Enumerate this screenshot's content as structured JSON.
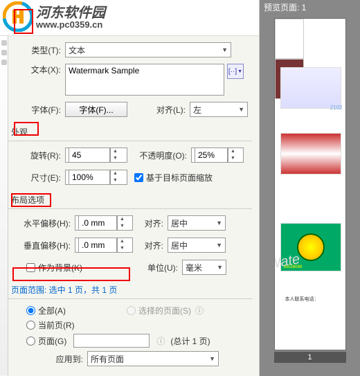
{
  "header": {
    "site_name": "河东软件园",
    "site_url": "www.pc0359.cn"
  },
  "preview": {
    "title": "预览页面: 1",
    "page_number": "1",
    "footer_text": "本人联系电话："
  },
  "form": {
    "type": {
      "label": "类型(T):",
      "value": "文本"
    },
    "text": {
      "label": "文本(X):",
      "value": "Watermark Sample"
    },
    "insert_btn": "[··]",
    "font": {
      "label": "字体(F):",
      "button": "字体(F)..."
    },
    "align": {
      "label": "对齐(L):",
      "value": "左"
    },
    "section_appearance": "外观",
    "rotation": {
      "label": "旋转(R):",
      "value": "45"
    },
    "opacity": {
      "label": "不透明度(O):",
      "value": "25%"
    },
    "size": {
      "label": "尺寸(E):",
      "value": "100%"
    },
    "scale_check": {
      "label": "基于目标页面缩放",
      "checked": true
    },
    "section_layout": "布局选项",
    "h_offset": {
      "label": "水平偏移(H):",
      "value": ".0 mm"
    },
    "h_align": {
      "label": "对齐:",
      "value": "居中"
    },
    "v_offset": {
      "label": "垂直偏移(H):",
      "value": ".0 mm"
    },
    "v_align": {
      "label": "对齐:",
      "value": "居中"
    },
    "background": {
      "label": "作为背景(K)",
      "checked": false
    },
    "unit": {
      "label": "单位(U):",
      "value": "毫米"
    },
    "page_range_title": "页面范围: 选中 1 页，共 1 页",
    "all_pages": {
      "label": "全部(A)",
      "checked": true
    },
    "selected_pages": {
      "label": "选择的页面(S)",
      "checked": false
    },
    "current_page": {
      "label": "当前页(R)",
      "checked": false
    },
    "pages": {
      "label": "页面(G)",
      "checked": false,
      "total": "(总计 1 页)"
    },
    "apply_to": {
      "label": "应用到:",
      "value": "所有页面"
    }
  },
  "watermark_preview_text": "Wate",
  "card_code": "95528089",
  "grad_label": "2102"
}
